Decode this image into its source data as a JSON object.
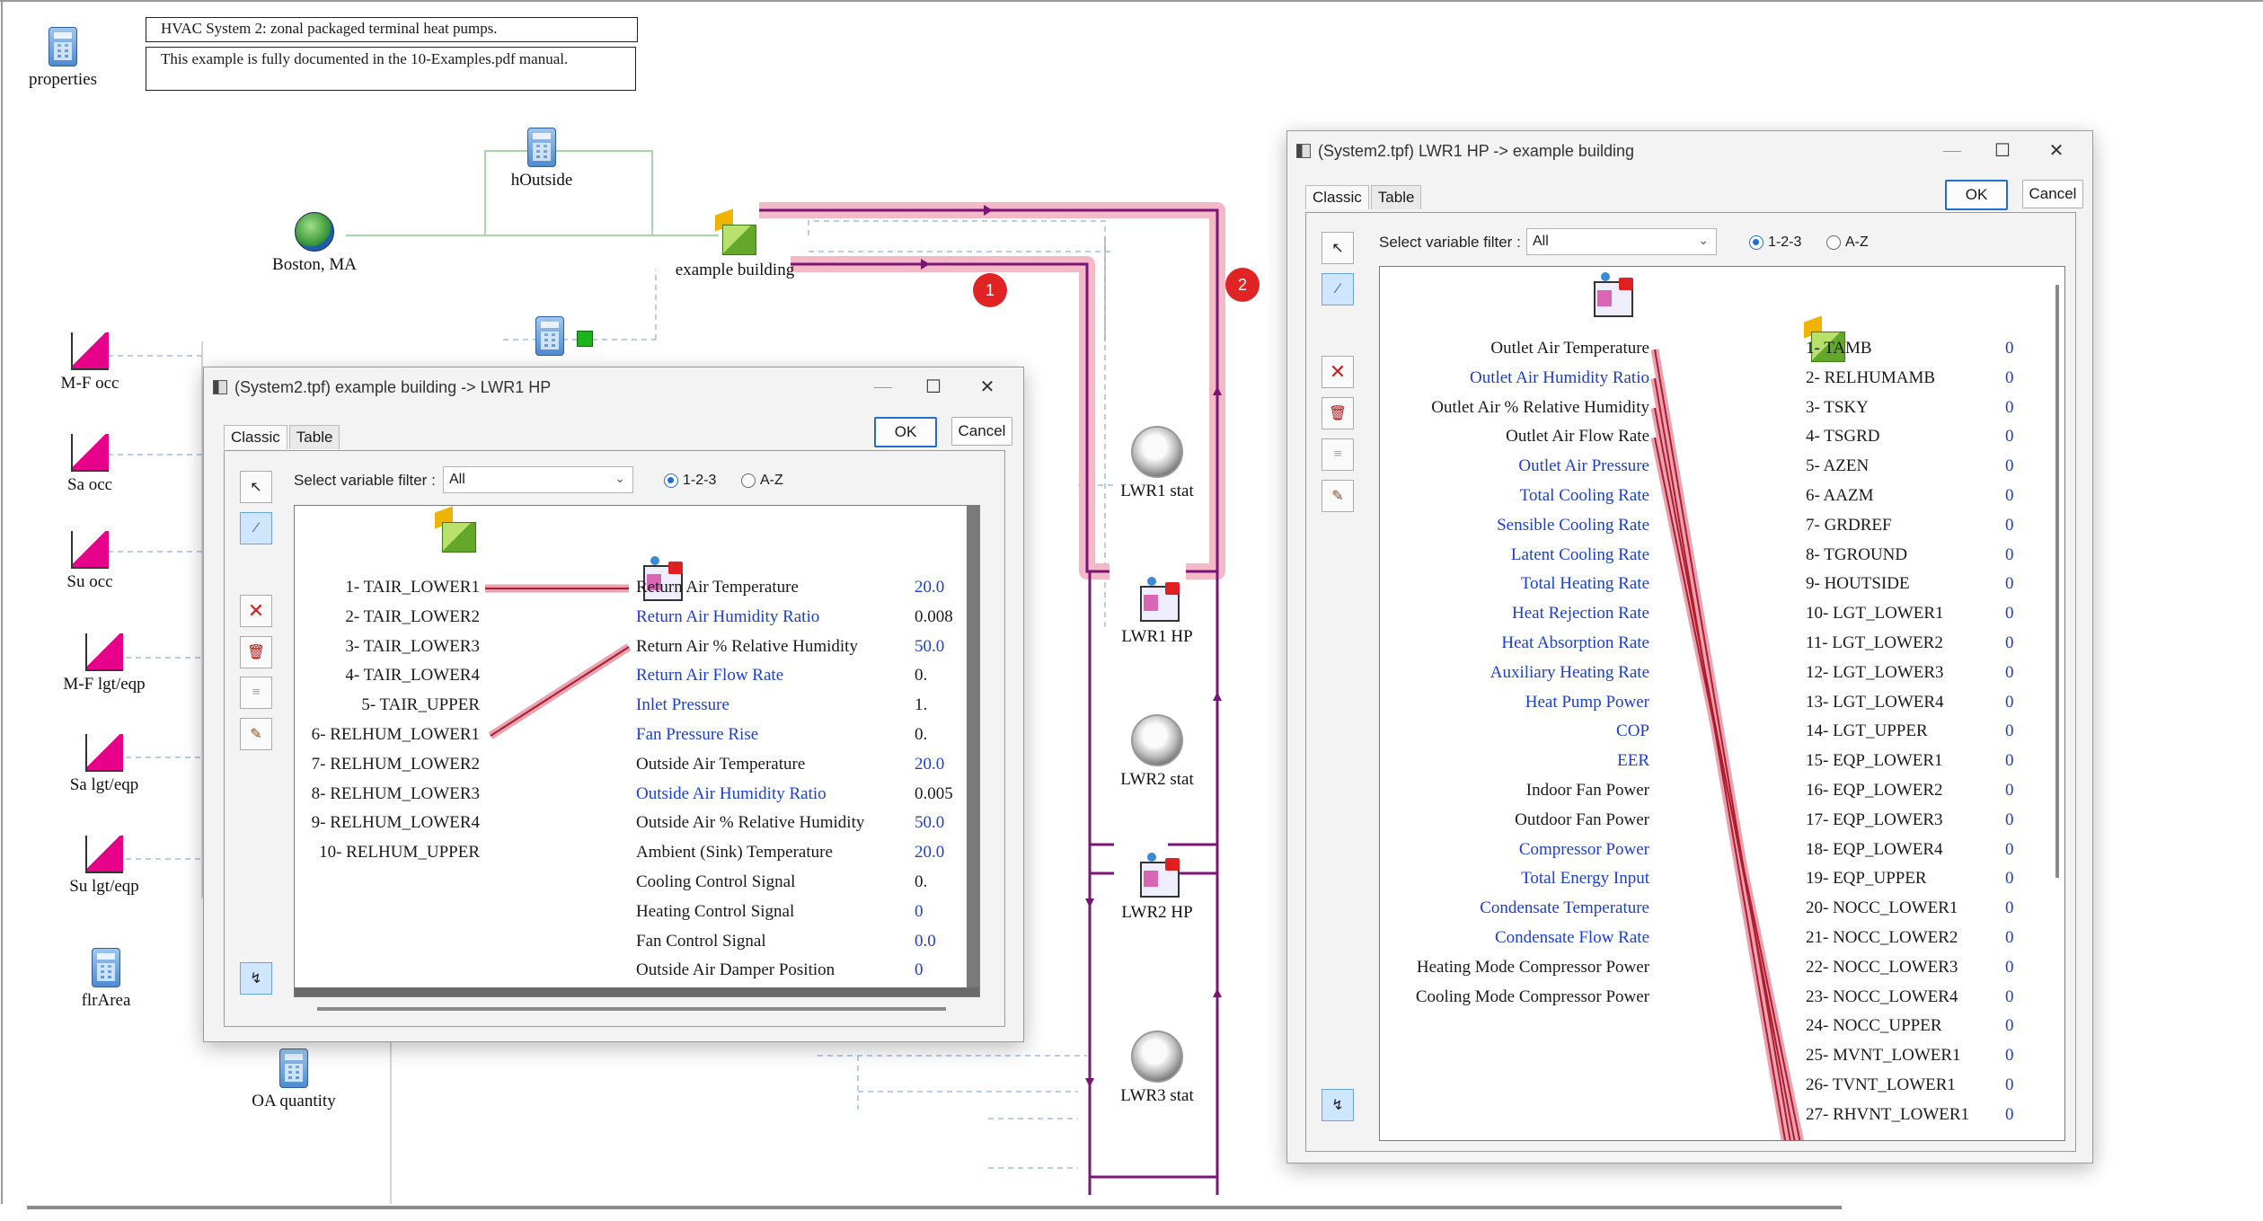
{
  "canvas": {
    "notes": [
      "HVAC System 2: zonal packaged terminal heat pumps.",
      "This example is fully documented in the 10-Examples.pdf manual."
    ],
    "components": {
      "properties": "properties",
      "houtside": "hOutside",
      "boston": "Boston, MA",
      "example_building": "example building",
      "mf_occ": "M-F occ",
      "sa_occ": "Sa occ",
      "su_occ": "Su occ",
      "mf_lgt": "M-F lgt/eqp",
      "sa_lgt": "Sa lgt/eqp",
      "su_lgt": "Su lgt/eqp",
      "flrarea": "flrArea",
      "oa_quantity": "OA quantity",
      "lwr1_stat": "LWR1 stat",
      "lwr1_hp": "LWR1 HP",
      "lwr2_stat": "LWR2 stat",
      "lwr2_hp": "LWR2 HP",
      "lwr3_stat": "LWR3 stat"
    },
    "markers": [
      "1",
      "2"
    ]
  },
  "dialog1": {
    "title": "(System2.tpf) example building -> LWR1 HP",
    "tabs": [
      "Classic",
      "Table"
    ],
    "ok": "OK",
    "cancel": "Cancel",
    "filter_label": "Select variable filter :",
    "filter_value": "All",
    "radio_123": "1-2-3",
    "radio_az": "A-Z",
    "outputs": [
      "1- TAIR_LOWER1",
      "2- TAIR_LOWER2",
      "3- TAIR_LOWER3",
      "4- TAIR_LOWER4",
      "5- TAIR_UPPER",
      "6- RELHUM_LOWER1",
      "7- RELHUM_LOWER2",
      "8- RELHUM_LOWER3",
      "9- RELHUM_LOWER4",
      "10- RELHUM_UPPER"
    ],
    "inputs": [
      {
        "name": "Return Air Temperature",
        "value": "20.0",
        "blue": false
      },
      {
        "name": "Return Air Humidity Ratio",
        "value": "0.008",
        "blue": true
      },
      {
        "name": "Return Air % Relative Humidity",
        "value": "50.0",
        "blue": false
      },
      {
        "name": "Return Air Flow Rate",
        "value": "0.",
        "blue": true
      },
      {
        "name": "Inlet Pressure",
        "value": "1.",
        "blue": true
      },
      {
        "name": "Fan Pressure Rise",
        "value": "0.",
        "blue": true
      },
      {
        "name": "Outside Air Temperature",
        "value": "20.0",
        "blue": false
      },
      {
        "name": "Outside Air Humidity Ratio",
        "value": "0.005",
        "blue": true
      },
      {
        "name": "Outside Air % Relative Humidity",
        "value": "50.0",
        "blue": false
      },
      {
        "name": "Ambient (Sink) Temperature",
        "value": "20.0",
        "blue": false
      },
      {
        "name": "Cooling Control Signal",
        "value": "0.",
        "blue": false
      },
      {
        "name": "Heating Control Signal",
        "value": "0",
        "blue": false
      },
      {
        "name": "Fan Control Signal",
        "value": "0.0",
        "blue": false
      },
      {
        "name": "Outside Air Damper Position",
        "value": "0",
        "blue": false
      }
    ]
  },
  "dialog2": {
    "title": "(System2.tpf) LWR1 HP -> example building",
    "tabs": [
      "Classic",
      "Table"
    ],
    "ok": "OK",
    "cancel": "Cancel",
    "filter_label": "Select variable filter :",
    "filter_value": "All",
    "radio_123": "1-2-3",
    "radio_az": "A-Z",
    "outputs": [
      {
        "name": "Outlet Air Temperature",
        "blue": false
      },
      {
        "name": "Outlet Air Humidity Ratio",
        "blue": true
      },
      {
        "name": "Outlet Air % Relative Humidity",
        "blue": false
      },
      {
        "name": "Outlet Air Flow Rate",
        "blue": false
      },
      {
        "name": "Outlet Air Pressure",
        "blue": true
      },
      {
        "name": "Total Cooling Rate",
        "blue": true
      },
      {
        "name": "Sensible Cooling Rate",
        "blue": true
      },
      {
        "name": "Latent Cooling Rate",
        "blue": true
      },
      {
        "name": "Total Heating Rate",
        "blue": true
      },
      {
        "name": "Heat Rejection Rate",
        "blue": true
      },
      {
        "name": "Heat Absorption Rate",
        "blue": true
      },
      {
        "name": "Auxiliary Heating Rate",
        "blue": true
      },
      {
        "name": "Heat Pump Power",
        "blue": true
      },
      {
        "name": "COP",
        "blue": true
      },
      {
        "name": "EER",
        "blue": true
      },
      {
        "name": "Indoor Fan Power",
        "blue": false
      },
      {
        "name": "Outdoor Fan Power",
        "blue": false
      },
      {
        "name": "Compressor Power",
        "blue": true
      },
      {
        "name": "Total Energy Input",
        "blue": true
      },
      {
        "name": "Condensate Temperature",
        "blue": true
      },
      {
        "name": "Condensate Flow Rate",
        "blue": true
      },
      {
        "name": "Heating Mode Compressor Power",
        "blue": false
      },
      {
        "name": "Cooling Mode Compressor Power",
        "blue": false
      }
    ],
    "inputs": [
      {
        "name": "1- TAMB",
        "value": "0"
      },
      {
        "name": "2- RELHUMAMB",
        "value": "0"
      },
      {
        "name": "3- TSKY",
        "value": "0"
      },
      {
        "name": "4- TSGRD",
        "value": "0"
      },
      {
        "name": "5- AZEN",
        "value": "0"
      },
      {
        "name": "6- AAZM",
        "value": "0"
      },
      {
        "name": "7- GRDREF",
        "value": "0"
      },
      {
        "name": "8- TGROUND",
        "value": "0"
      },
      {
        "name": "9- HOUTSIDE",
        "value": "0"
      },
      {
        "name": "10- LGT_LOWER1",
        "value": "0"
      },
      {
        "name": "11- LGT_LOWER2",
        "value": "0"
      },
      {
        "name": "12- LGT_LOWER3",
        "value": "0"
      },
      {
        "name": "13- LGT_LOWER4",
        "value": "0"
      },
      {
        "name": "14- LGT_UPPER",
        "value": "0"
      },
      {
        "name": "15- EQP_LOWER1",
        "value": "0"
      },
      {
        "name": "16- EQP_LOWER2",
        "value": "0"
      },
      {
        "name": "17- EQP_LOWER3",
        "value": "0"
      },
      {
        "name": "18- EQP_LOWER4",
        "value": "0"
      },
      {
        "name": "19- EQP_UPPER",
        "value": "0"
      },
      {
        "name": "20- NOCC_LOWER1",
        "value": "0"
      },
      {
        "name": "21- NOCC_LOWER2",
        "value": "0"
      },
      {
        "name": "22- NOCC_LOWER3",
        "value": "0"
      },
      {
        "name": "23- NOCC_LOWER4",
        "value": "0"
      },
      {
        "name": "24- NOCC_UPPER",
        "value": "0"
      },
      {
        "name": "25- MVNT_LOWER1",
        "value": "0"
      },
      {
        "name": "26- TVNT_LOWER1",
        "value": "0"
      },
      {
        "name": "27- RHVNT_LOWER1",
        "value": "0"
      }
    ]
  }
}
